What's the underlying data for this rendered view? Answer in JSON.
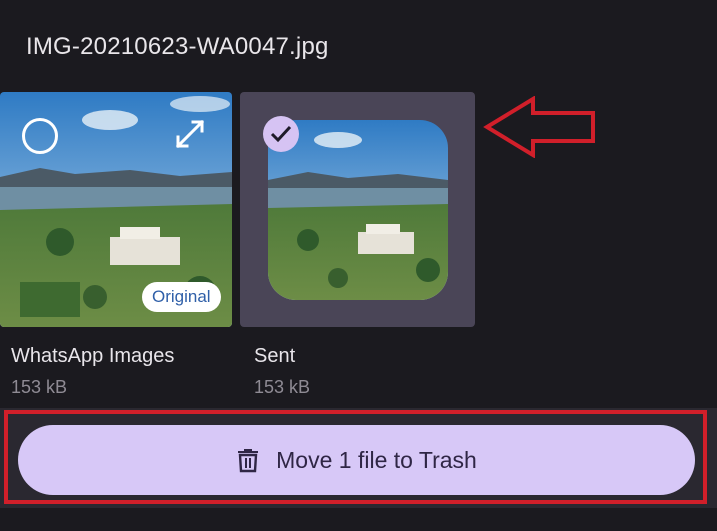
{
  "title": "IMG-20210623-WA0047.jpg",
  "options": [
    {
      "folder": "WhatsApp Images",
      "size": "153 kB",
      "badge": "Original",
      "selected": false
    },
    {
      "folder": "Sent",
      "size": "153 kB",
      "selected": true
    }
  ],
  "action_button": {
    "label": "Move 1 file to Trash",
    "icon": "trash-icon"
  },
  "colors": {
    "accent": "#d7c8f7",
    "annotation": "#d11f2a",
    "selected_card": "#4a4557"
  }
}
